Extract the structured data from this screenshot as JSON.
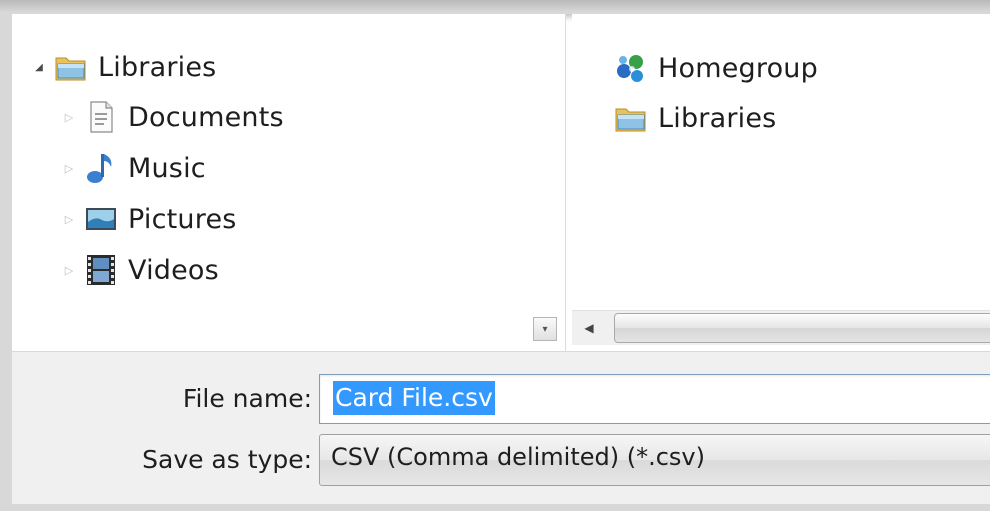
{
  "nav_tree": {
    "libraries": "Libraries",
    "documents": "Documents",
    "music": "Music",
    "pictures": "Pictures",
    "videos": "Videos"
  },
  "content": {
    "homegroup": "Homegroup",
    "libraries": "Libraries"
  },
  "form": {
    "file_name_label": "File name:",
    "file_name_value": "Card File.csv",
    "save_type_label": "Save as type:",
    "save_type_value": "CSV (Comma delimited) (*.csv)"
  },
  "icons": {
    "libraries": "libraries-folder-icon",
    "documents": "document-icon",
    "music": "music-note-icon",
    "pictures": "pictures-icon",
    "videos": "film-strip-icon",
    "homegroup": "homegroup-icon"
  },
  "colors": {
    "selection": "#3399ff",
    "form_background": "#f0f0f0"
  }
}
